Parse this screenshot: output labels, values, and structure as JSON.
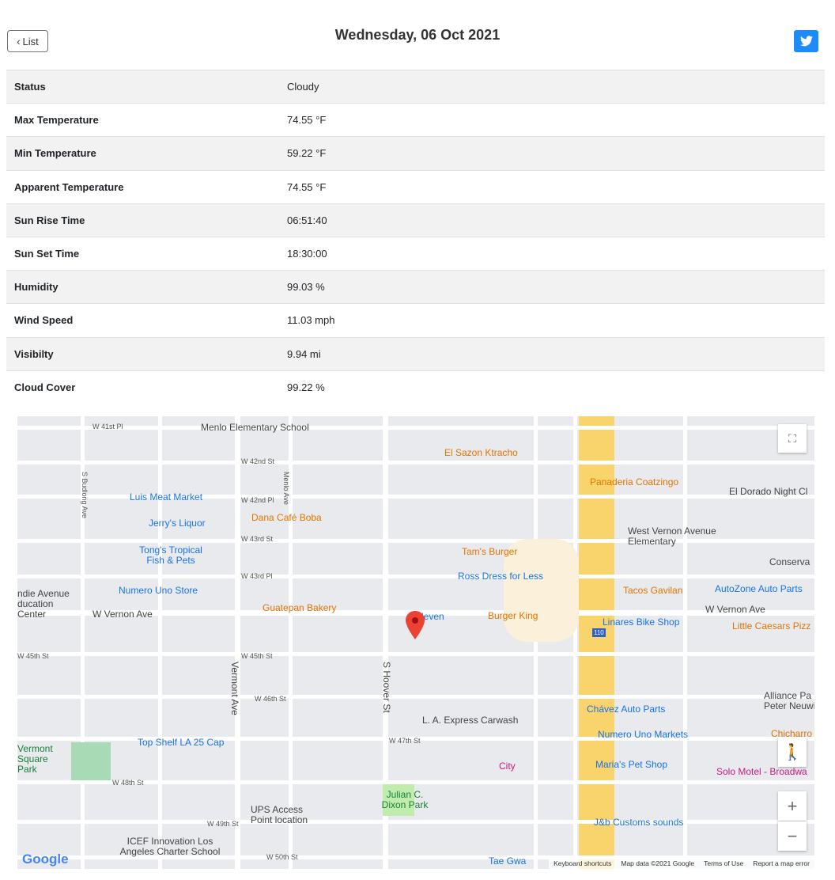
{
  "header": {
    "back_label": "List",
    "title": "Wednesday, 06 Oct 2021"
  },
  "rows": [
    {
      "label": "Status",
      "value": "Cloudy"
    },
    {
      "label": "Max Temperature",
      "value": "74.55 °F"
    },
    {
      "label": "Min Temperature",
      "value": "59.22 °F"
    },
    {
      "label": "Apparent Temperature",
      "value": "74.55 °F"
    },
    {
      "label": "Sun Rise Time",
      "value": "06:51:40"
    },
    {
      "label": "Sun Set Time",
      "value": "18:30:00"
    },
    {
      "label": "Humidity",
      "value": "99.03 %"
    },
    {
      "label": "Wind Speed",
      "value": "11.03 mph"
    },
    {
      "label": "Visibilty",
      "value": "9.94 mi"
    },
    {
      "label": "Cloud Cover",
      "value": "99.22 %"
    }
  ],
  "map": {
    "places": [
      "Menlo Elementary School",
      "Luis Meat Market",
      "Jerry's Liquor",
      "Dana Café Boba",
      "Tong's Tropical Fish & Pets",
      "Numero Uno Store",
      "Guatepan Bakery",
      "El Sazon Ktracho",
      "Tam's Burger",
      "Ross Dress for Less",
      "Burger King",
      "Panaderia Coatzingo",
      "El Dorado Night Cl",
      "West Vernon Avenue Elementary",
      "Tacos Gavilan",
      "AutoZone Auto Parts",
      "Linares Bike Shop",
      "Little Caesars Pizz",
      "Chávez Auto Parts",
      "Numero Uno Markets",
      "Maria's Pet Shop",
      "Solo Motel - Broadwa",
      "L. A. Express Carwash",
      "City",
      "Top Shelf LA 25 Cap",
      "UPS Access Point location",
      "Julian C. Dixon Park",
      "ICEF Innovation Los Angeles Charter School",
      "J&b Customs sounds",
      "Vermont Square Park",
      "ndie Avenue ducation Center",
      "Eleven",
      "Alliance Pa Peter Neuwi",
      "Chicharro",
      "Conserva",
      "Tae Gwa"
    ],
    "streets": [
      "W 41st Pl",
      "W 42nd St",
      "W 42nd Pl",
      "W 43rd St",
      "W 43rd Pl",
      "W Vernon Ave",
      "W 45th St",
      "W 46th St",
      "W 47th St",
      "W 48th St",
      "W 49th St",
      "W 50th St",
      "S Budlong Ave",
      "Vermont Ave",
      "S Hoover St",
      "Menlo Ave",
      "110"
    ],
    "footer": {
      "keyboard": "Keyboard shortcuts",
      "data": "Map data ©2021 Google",
      "terms": "Terms of Use",
      "report": "Report a map error"
    },
    "logo": "Google"
  }
}
